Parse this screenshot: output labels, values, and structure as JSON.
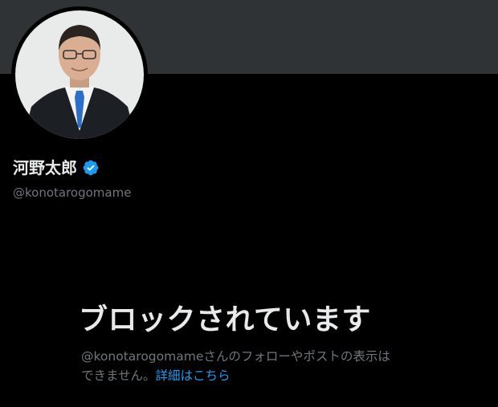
{
  "profile": {
    "display_name": "河野太郎",
    "handle": "@konotarogomame",
    "verified": true,
    "verified_icon": "verified-badge-icon"
  },
  "blocked": {
    "title": "ブロックされています",
    "desc_line1": "@konotarogomameさんのフォローやポストの表示は",
    "desc_line2": "できません。",
    "link_label": "詳細はこちら"
  },
  "colors": {
    "background": "#000000",
    "banner": "#2f3336",
    "primary_text": "#e7e9ea",
    "secondary_text": "#71767b",
    "link": "#1d9bf0",
    "verified": "#1d9bf0"
  }
}
